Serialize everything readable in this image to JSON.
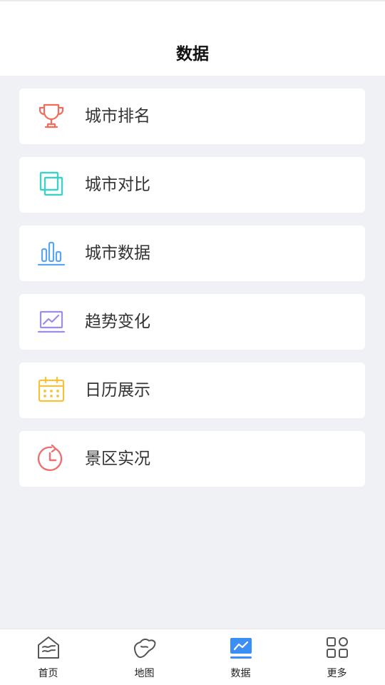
{
  "header": {
    "title": "数据"
  },
  "menu": {
    "items": [
      {
        "label": "城市排名",
        "icon": "trophy-icon",
        "color": "#f26b5b"
      },
      {
        "label": "城市对比",
        "icon": "compare-squares-icon",
        "color": "#3fd0c6"
      },
      {
        "label": "城市数据",
        "icon": "bar-chart-icon",
        "color": "#5aa6f2"
      },
      {
        "label": "趋势变化",
        "icon": "trend-chart-icon",
        "color": "#9b8de8"
      },
      {
        "label": "日历展示",
        "icon": "calendar-icon",
        "color": "#f5c33b"
      },
      {
        "label": "景区实况",
        "icon": "clock-icon",
        "color": "#ef6f6f"
      }
    ]
  },
  "bottom_nav": {
    "items": [
      {
        "label": "首页",
        "icon": "home-icon"
      },
      {
        "label": "地图",
        "icon": "map-icon"
      },
      {
        "label": "数据",
        "icon": "data-chart-icon",
        "active": true
      },
      {
        "label": "更多",
        "icon": "grid-icon"
      }
    ],
    "active_color": "#3a8ef6",
    "inactive_color": "#555555"
  }
}
